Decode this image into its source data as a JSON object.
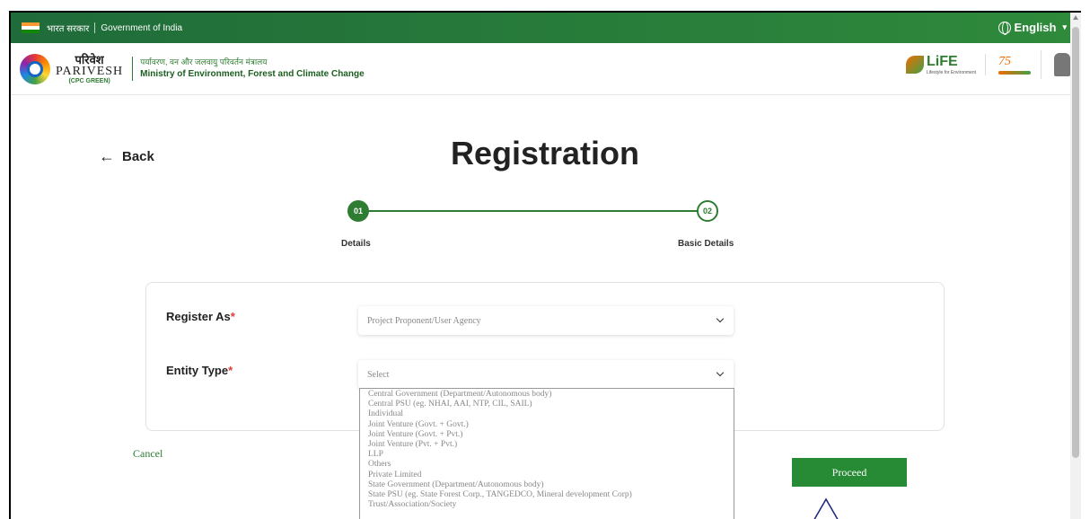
{
  "gov_bar": {
    "hindi_text": "भारत सरकार",
    "english_text": "Government of India",
    "language": "English"
  },
  "brand": {
    "parivesh_hindi": "परिवेश",
    "parivesh_english": "PARIVESH",
    "cpc": "(CPC GREEN)",
    "ministry_hindi": "पर्यावरण, वन और जलवायु परिवर्तन मंत्रालय",
    "ministry_english": "Ministry of Environment, Forest and Climate Change",
    "life_logo": "LiFE",
    "life_sub": "Lifestyle for Environment",
    "amrit_logo": "75"
  },
  "page": {
    "back_label": "Back",
    "title": "Registration"
  },
  "stepper": {
    "steps": [
      {
        "number": "01",
        "label": "Details"
      },
      {
        "number": "02",
        "label": "Basic Details"
      }
    ]
  },
  "form": {
    "register_as": {
      "label": "Register As",
      "value": "Project Proponent/User Agency"
    },
    "entity_type": {
      "label": "Entity Type",
      "value": "Select"
    },
    "required_mark": "*"
  },
  "entity_options": [
    "Central Government (Department/Autonomous body)",
    "Central PSU (eg. NHAI, AAI, NTP, CIL, SAIL)",
    "Individual",
    "Joint Venture (Govt. + Govt.)",
    "Joint Venture (Govt. + Pvt.)",
    "Joint Venture (Pvt. + Pvt.)",
    "LLP",
    "Others",
    "Private Limited",
    "State Government (Department/Autonomous body)",
    "State PSU (eg. State Forest Corp., TANGEDCO, Mineral development Corp)",
    "Trust/Association/Society"
  ],
  "actions": {
    "cancel": "Cancel",
    "proceed": "Proceed"
  },
  "colors": {
    "primary_green": "#2e7d32",
    "required_red": "#e53935"
  }
}
